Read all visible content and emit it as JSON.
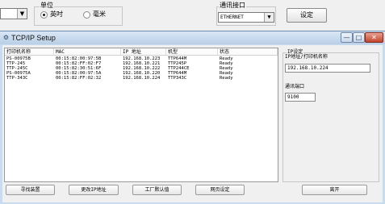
{
  "background": {
    "unit_group": {
      "legend": "单位",
      "options": [
        {
          "label": "英吋",
          "selected": true
        },
        {
          "label": "毫米",
          "selected": false
        }
      ]
    },
    "comm_group": {
      "legend": "通讯接口",
      "selected": "ETHERNET"
    },
    "set_button": "设定"
  },
  "window": {
    "title": "TCP/IP Setup",
    "controls": {
      "minimize": "—",
      "maximize": "□",
      "close": "✕"
    }
  },
  "printer_list": {
    "columns": [
      "打印机名称",
      "MAC",
      "IP 地址",
      "机型",
      "状态"
    ],
    "rows": [
      [
        "PS-00975B",
        "00:15:82:00:97:5B",
        "192.168.10.223",
        "TTP644M",
        "Ready"
      ],
      [
        "TTP-245",
        "00:15:82:FF:02:F7",
        "192.168.10.221",
        "TTP245P",
        "Ready"
      ],
      [
        "TTP-245C",
        "00:15:82:30:51:6F",
        "192.168.10.222",
        "TTP244CE",
        "Ready"
      ],
      [
        "PS-00975A",
        "00:15:82:00:97:5A",
        "192.168.10.220",
        "TTP644M",
        "Ready"
      ],
      [
        "TTP-343C",
        "00:15:82:FF:02:32",
        "192.168.10.224",
        "TTP343C",
        "Ready"
      ]
    ]
  },
  "ip_settings": {
    "legend": "IP设定",
    "ip_label": "IP地址/打印机名称",
    "ip_value": "192.168.10.224",
    "port_label": "通讯端口",
    "port_value": "9100"
  },
  "buttons": {
    "search": "寻找装置",
    "change_ip": "更改IP地址",
    "factory_default": "工厂默认值",
    "web_setup": "网页设定",
    "exit": "离开"
  },
  "colors": {
    "window_frame": "#c9dcef",
    "close_button": "#c3452b"
  }
}
